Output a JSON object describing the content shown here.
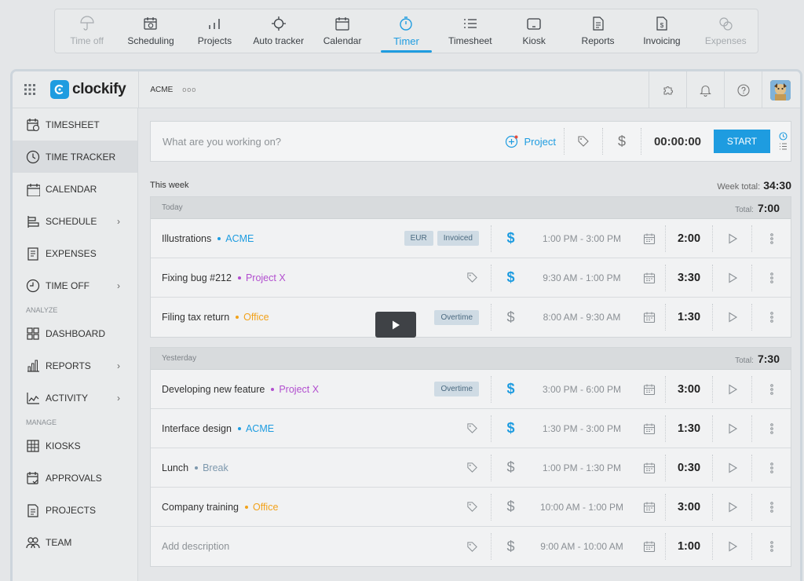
{
  "feature_nav": [
    {
      "label": "Time off",
      "icon": "umbrella-icon",
      "state": "dim"
    },
    {
      "label": "Scheduling",
      "icon": "calendar-clock-icon",
      "state": "normal"
    },
    {
      "label": "Projects",
      "icon": "bar-chart-icon",
      "state": "normal"
    },
    {
      "label": "Auto tracker",
      "icon": "crosshair-icon",
      "state": "normal"
    },
    {
      "label": "Calendar",
      "icon": "calendar-icon",
      "state": "normal"
    },
    {
      "label": "Timer",
      "icon": "stopwatch-icon",
      "state": "active"
    },
    {
      "label": "Timesheet",
      "icon": "list-icon",
      "state": "normal"
    },
    {
      "label": "Kiosk",
      "icon": "tablet-icon",
      "state": "normal"
    },
    {
      "label": "Reports",
      "icon": "document-icon",
      "state": "normal"
    },
    {
      "label": "Invoicing",
      "icon": "invoice-icon",
      "state": "normal"
    },
    {
      "label": "Expenses",
      "icon": "coins-icon",
      "state": "dim"
    }
  ],
  "header": {
    "logo_text": "clockify",
    "workspace": "ACME",
    "workspace_more": "ooo"
  },
  "sidebar": {
    "items": [
      {
        "label": "TIMESHEET",
        "icon": "timesheet-icon",
        "active": false,
        "chevron": false
      },
      {
        "label": "TIME TRACKER",
        "icon": "clock-icon",
        "active": true,
        "chevron": false
      },
      {
        "label": "CALENDAR",
        "icon": "calendar-icon",
        "active": false,
        "chevron": false
      },
      {
        "label": "SCHEDULE",
        "icon": "schedule-icon",
        "active": false,
        "chevron": true
      },
      {
        "label": "EXPENSES",
        "icon": "receipt-icon",
        "active": false,
        "chevron": false
      },
      {
        "label": "TIME OFF",
        "icon": "time-off-icon",
        "active": false,
        "chevron": true
      }
    ],
    "analyze_label": "ANALYZE",
    "analyze_items": [
      {
        "label": "DASHBOARD",
        "icon": "dashboard-icon",
        "chevron": false
      },
      {
        "label": "REPORTS",
        "icon": "reports-icon",
        "chevron": true
      },
      {
        "label": "ACTIVITY",
        "icon": "activity-icon",
        "chevron": true
      }
    ],
    "manage_label": "MANAGE",
    "manage_items": [
      {
        "label": "KIOSKS",
        "icon": "kiosk-icon",
        "chevron": false
      },
      {
        "label": "APPROVALS",
        "icon": "approvals-icon",
        "chevron": false
      },
      {
        "label": "PROJECTS",
        "icon": "projects-icon",
        "chevron": false
      },
      {
        "label": "TEAM",
        "icon": "team-icon",
        "chevron": false
      }
    ]
  },
  "timer": {
    "placeholder": "What are you working on?",
    "project_label": "Project",
    "time": "00:00:00",
    "start_label": "START"
  },
  "week": {
    "label": "This week",
    "total_label": "Week total:",
    "total": "34:30"
  },
  "days": [
    {
      "name": "Today",
      "total_label": "Total:",
      "total": "7:00",
      "entries": [
        {
          "description": "Illustrations",
          "project": "ACME",
          "project_color": "#1e9ce0",
          "badges": [
            "EUR",
            "Invoiced"
          ],
          "billable": true,
          "time": "1:00 PM - 3:00 PM",
          "duration": "2:00"
        },
        {
          "description": "Fixing bug #212",
          "project": "Project X",
          "project_color": "#b24fcf",
          "badges": [],
          "billable": true,
          "time": "9:30 AM - 1:00 PM",
          "duration": "3:30"
        },
        {
          "description": "Filing tax return",
          "project": "Office",
          "project_color": "#f2a21a",
          "badges": [
            "Overtime"
          ],
          "billable": false,
          "time": "8:00 AM - 9:30 AM",
          "duration": "1:30"
        }
      ]
    },
    {
      "name": "Yesterday",
      "total_label": "Total:",
      "total": "7:30",
      "entries": [
        {
          "description": "Developing new feature",
          "project": "Project X",
          "project_color": "#b24fcf",
          "badges": [
            "Overtime"
          ],
          "billable": true,
          "time": "3:00 PM - 6:00 PM",
          "duration": "3:00"
        },
        {
          "description": "Interface design",
          "project": "ACME",
          "project_color": "#1e9ce0",
          "badges": [],
          "billable": true,
          "time": "1:30 PM - 3:00 PM",
          "duration": "1:30"
        },
        {
          "description": "Lunch",
          "project": "Break",
          "project_color": "#7d98ad",
          "badges": [],
          "billable": false,
          "time": "1:00 PM - 1:30 PM",
          "duration": "0:30"
        },
        {
          "description": "Company training",
          "project": "Office",
          "project_color": "#f2a21a",
          "badges": [],
          "billable": false,
          "time": "10:00 AM - 1:00 PM",
          "duration": "3:00"
        },
        {
          "description": "Add description",
          "project": "",
          "project_color": "",
          "badges": [],
          "billable": false,
          "time": "9:00 AM - 10:00 AM",
          "duration": "1:00"
        }
      ]
    }
  ],
  "colors": {
    "accent": "#1e9ce0",
    "project_x": "#b24fcf",
    "office": "#f2a21a",
    "break": "#7d98ad"
  }
}
